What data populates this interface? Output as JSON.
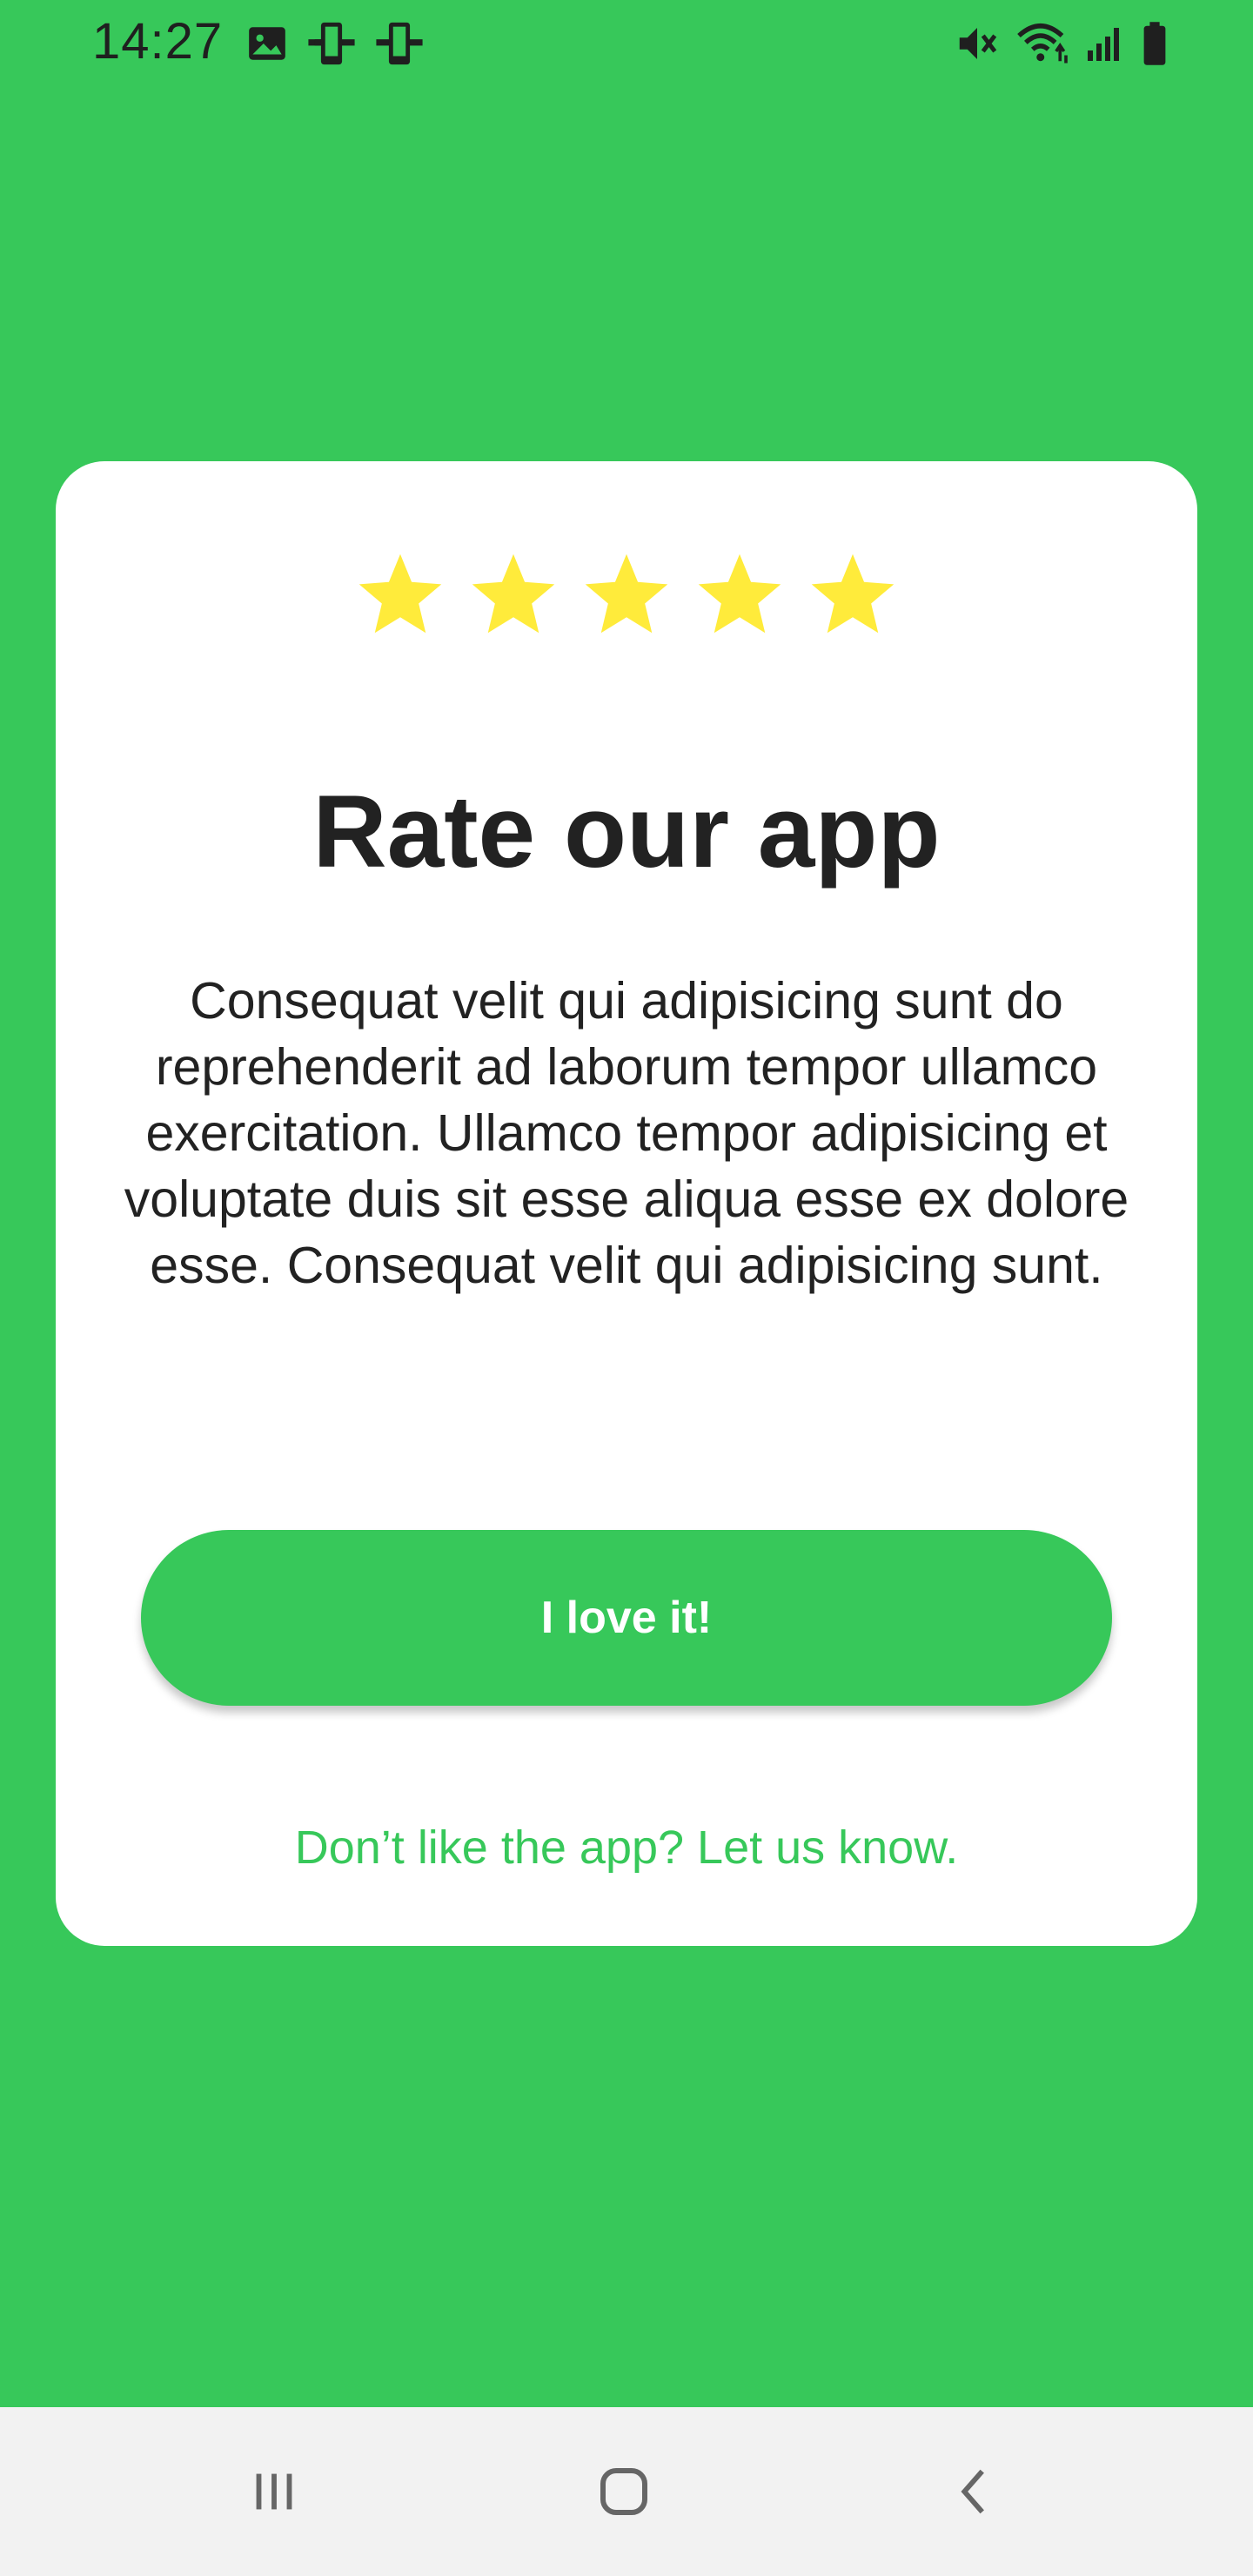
{
  "status_bar": {
    "time": "14:27",
    "left_icons": [
      "image-icon",
      "device-icon",
      "device-icon"
    ],
    "right_icons": [
      "mute-icon",
      "wifi-icon",
      "signal-icon",
      "battery-icon"
    ]
  },
  "rating_dialog": {
    "stars": 5,
    "star_color": "#ffeb3b",
    "title": "Rate our app",
    "body": "Consequat velit qui adipisicing sunt do reprehenderit ad laborum tempor ullamco exercitation. Ullamco tempor adipisicing et voluptate duis sit esse aliqua esse ex dolore esse. Consequat velit qui adipisicing sunt.",
    "primary_button_label": "I love it!",
    "secondary_link_label": "Don’t like the app? Let us know."
  },
  "colors": {
    "background": "#37c85a",
    "card": "#ffffff",
    "text": "#222222",
    "nav_bar": "#f2f2f2"
  },
  "nav_bar": {
    "buttons": [
      "recent-apps-icon",
      "home-icon",
      "back-icon"
    ]
  }
}
